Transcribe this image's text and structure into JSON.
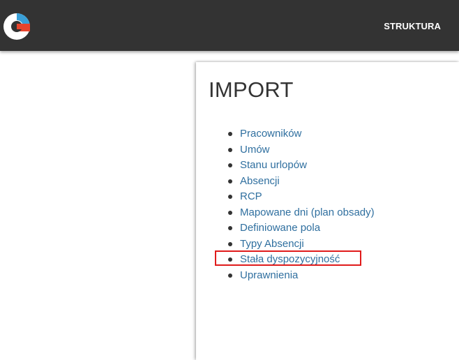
{
  "header": {
    "logo_icon": "app-logo-icon",
    "nav_link_label": "STRUKTURA",
    "background_color": "#333333"
  },
  "panel": {
    "title": "IMPORT",
    "items": [
      {
        "label": "Pracowników"
      },
      {
        "label": "Umów"
      },
      {
        "label": "Stanu urlopów"
      },
      {
        "label": "Absencji"
      },
      {
        "label": "RCP"
      },
      {
        "label": "Mapowane dni (plan obsady)"
      },
      {
        "label": "Definiowane pola"
      },
      {
        "label": "Typy Absencji"
      },
      {
        "label": "Stała dyspozycyjność"
      },
      {
        "label": "Uprawnienia"
      }
    ],
    "link_color": "#2f6f9f",
    "highlighted_item": "Stała dyspozycyjność",
    "highlight_color": "#e01b1b"
  }
}
